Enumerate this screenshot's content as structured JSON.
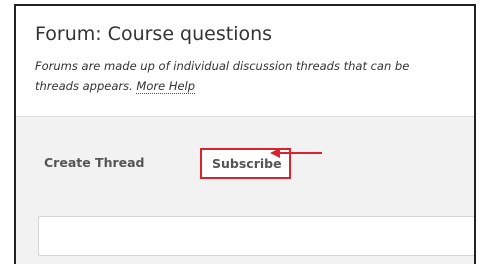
{
  "forum": {
    "title": "Forum: Course questions",
    "description_line1": "Forums are made up of individual discussion threads that can be",
    "description_line2_prefix": "threads appears. ",
    "help_link": "More Help"
  },
  "toolbar": {
    "create_thread_label": "Create Thread",
    "subscribe_label": "Subscribe"
  },
  "colors": {
    "highlight_border": "#d9232d",
    "toolbar_background": "#f2f2f2",
    "text": "#333333"
  }
}
